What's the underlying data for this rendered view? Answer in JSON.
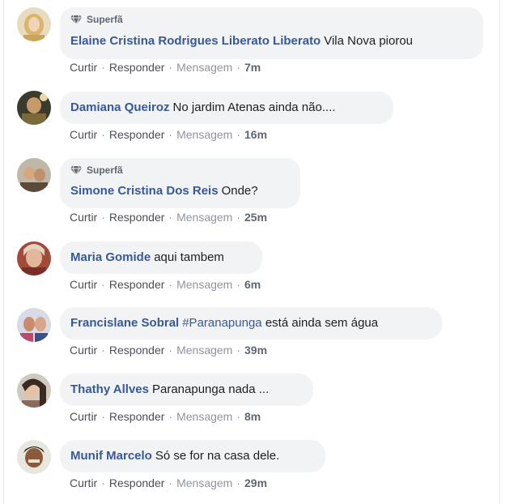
{
  "badge_label": "Superfã",
  "actions": {
    "like": "Curtir",
    "reply": "Responder",
    "message": "Mensagem",
    "separator": "·"
  },
  "comments": [
    {
      "author": "Elaine Cristina Rodrigues Liberato Liberato",
      "text": "Vila Nova piorou",
      "time": "7m",
      "badge": true
    },
    {
      "author": "Damiana Queiroz",
      "text": "No jardim Atenas ainda não....",
      "time": "16m",
      "badge": false
    },
    {
      "author": "Simone Cristina Dos Reis",
      "text": "Onde?",
      "time": "25m",
      "badge": true
    },
    {
      "author": "Maria Gomide",
      "text": "aqui tambem",
      "time": "6m",
      "badge": false
    },
    {
      "author": "Francislane Sobral",
      "hashtag": "#Paranapunga",
      "text": "está ainda sem água",
      "time": "39m",
      "badge": false
    },
    {
      "author": "Thathy Allves",
      "text": "Paranapunga nada ...",
      "time": "8m",
      "badge": false
    },
    {
      "author": "Munif Marcelo",
      "text": "Só se for na casa dele.",
      "time": "29m",
      "badge": false
    }
  ],
  "colors": {
    "name": "#385898",
    "bubble": "#f2f3f5",
    "text": "#1c1e21",
    "meta": "#606770"
  }
}
